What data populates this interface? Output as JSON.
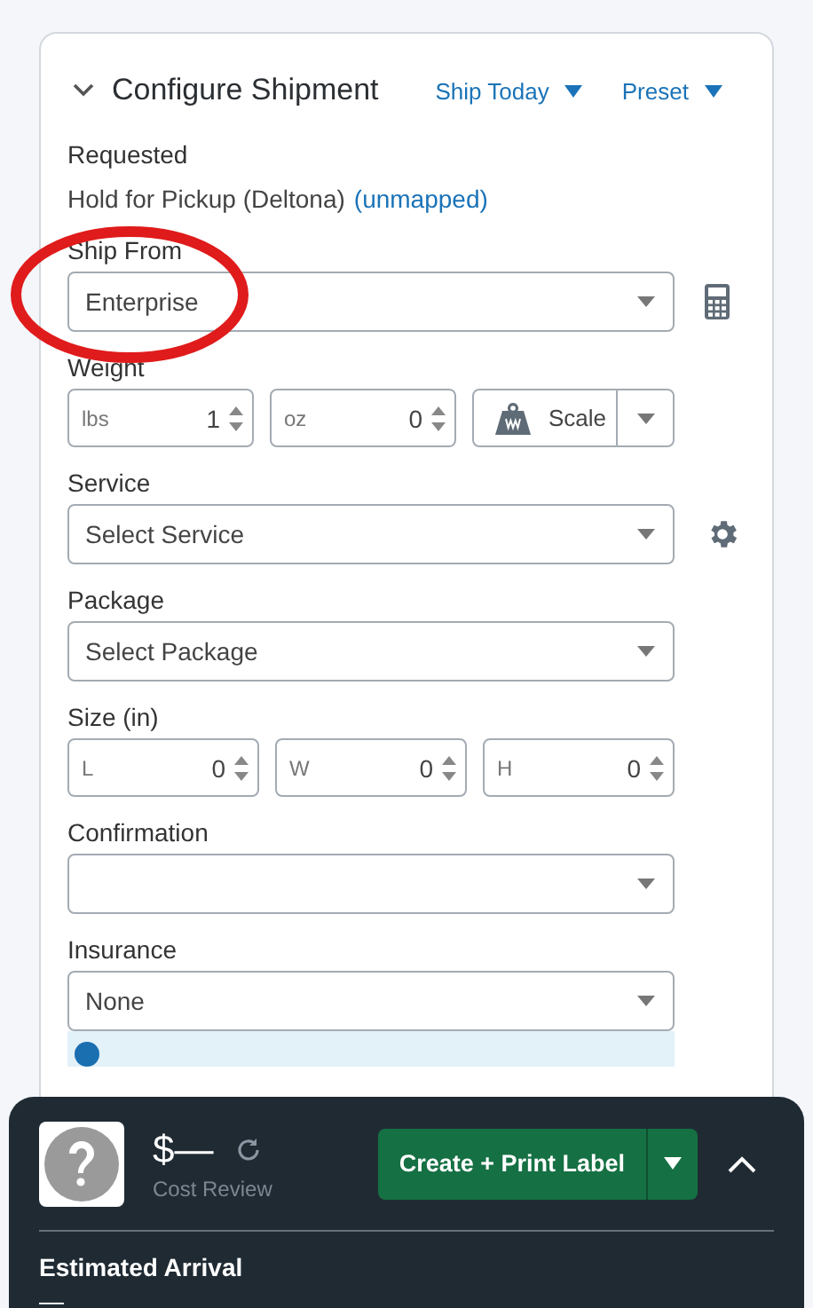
{
  "header": {
    "title": "Configure Shipment",
    "expanded": true,
    "menus": [
      {
        "label": "Ship Today"
      },
      {
        "label": "Preset"
      }
    ]
  },
  "requested": {
    "label": "Requested",
    "value": "Hold for Pickup (Deltona)",
    "link": "(unmapped)"
  },
  "fields": [
    {
      "kind": "calcselect",
      "label": "Ship From",
      "value": "Enterprise"
    },
    {
      "kind": "numbers",
      "label": "Weight",
      "inputs": [
        {
          "unit": "lbs",
          "value": "1"
        },
        {
          "unit": "oz",
          "value": "0"
        }
      ],
      "scale_button": "Scale"
    },
    {
      "kind": "gearselect",
      "label": "Service",
      "placeholder": "Select Service"
    },
    {
      "kind": "select",
      "label": "Package",
      "placeholder": "Select Package"
    },
    {
      "kind": "numbers",
      "label": "Size (in)",
      "inputs": [
        {
          "unit": "L",
          "value": "0"
        },
        {
          "unit": "W",
          "value": "0"
        },
        {
          "unit": "H",
          "value": "0"
        }
      ]
    },
    {
      "kind": "select",
      "label": "Confirmation"
    },
    {
      "kind": "select",
      "label": "Insurance",
      "value": "None"
    }
  ],
  "footer": {
    "cost": "$—",
    "cost_label": "Cost Review",
    "primary_button": "Create + Print Label",
    "arrival_label": "Estimated Arrival",
    "arrival": "—"
  }
}
